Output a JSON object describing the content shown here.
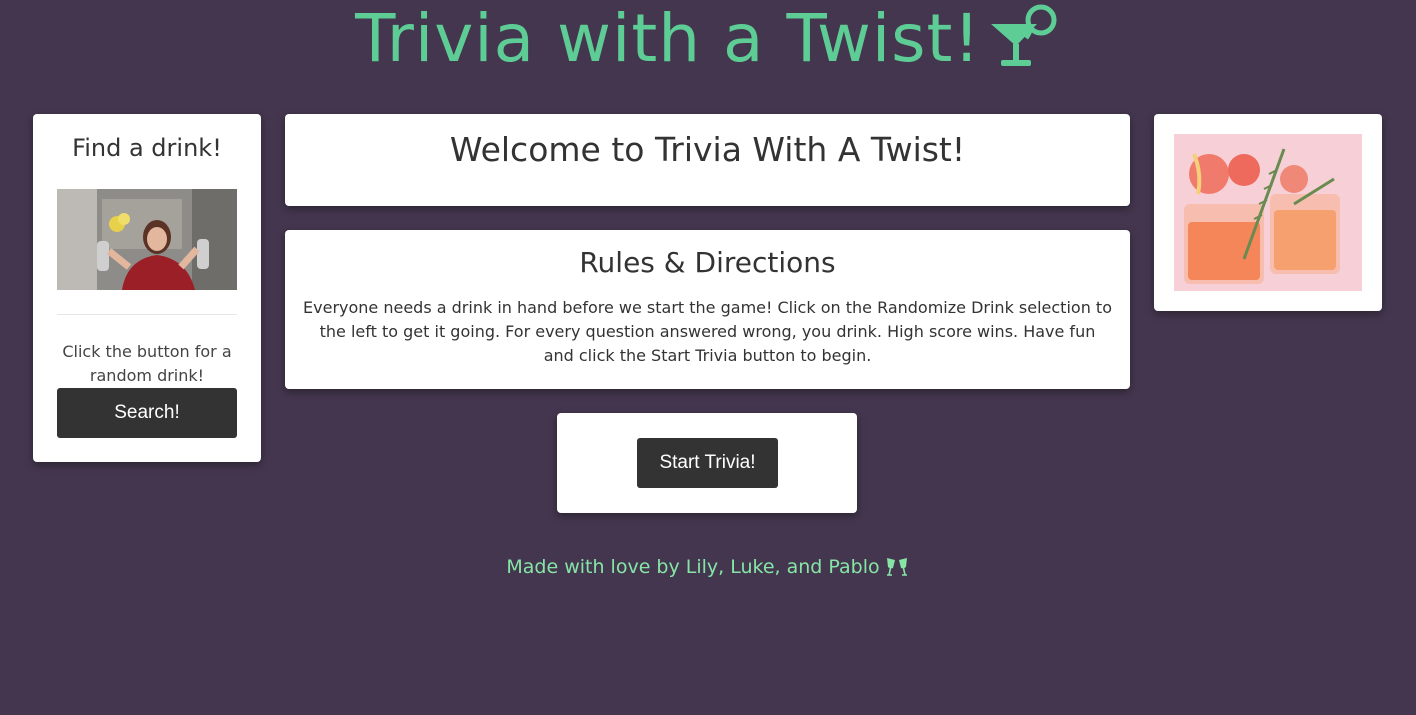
{
  "header": {
    "title": "Trivia with a Twist!",
    "icon": "cocktail-glass-icon",
    "color": "#5dcd95"
  },
  "find_drink": {
    "heading": "Find a drink!",
    "image": "celebrating-woman-gif",
    "hint": "Click the button for a random drink!",
    "search_label": "Search!"
  },
  "welcome": {
    "title": "Welcome to Trivia With A Twist!"
  },
  "rules": {
    "title": "Rules & Directions",
    "text": "Everyone needs a drink in hand before we start the game! Click on the Randomize Drink selection to the left to get it going. For every question answered wrong, you drink. High score wins. Have fun and click the Start Trivia button to begin."
  },
  "start": {
    "label": "Start Trivia!"
  },
  "drink_image": {
    "image": "grapefruit-cocktail-photo"
  },
  "footer": {
    "text": "Made with love by Lily, Luke, and Pablo",
    "icon": "clinking-glasses-icon",
    "color": "#86e5a6"
  },
  "colors": {
    "background": "#43364e",
    "card": "#ffffff",
    "button": "#333333"
  }
}
